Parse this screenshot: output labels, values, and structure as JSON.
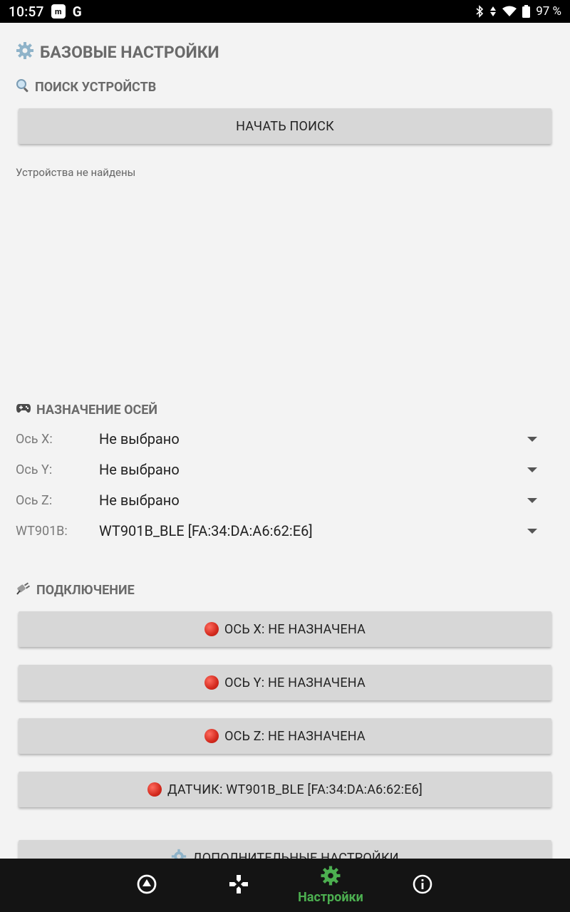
{
  "status_bar": {
    "time": "10:57",
    "app_badge": "m",
    "google_letter": "G",
    "battery_percent": "97 %"
  },
  "page": {
    "title": "БАЗОВЫЕ НАСТРОЙКИ",
    "title_icon": "gear-icon"
  },
  "search": {
    "heading": "ПОИСК УСТРОЙСТВ",
    "heading_icon": "magnifier-icon",
    "button_label": "НАЧАТЬ ПОИСК",
    "empty_message": "Устройства не найдены"
  },
  "axes": {
    "heading": "НАЗНАЧЕНИЕ ОСЕЙ",
    "heading_icon": "gamepad-icon",
    "rows": [
      {
        "label": "Ось X:",
        "value": "Не выбрано"
      },
      {
        "label": "Ось Y:",
        "value": "Не выбрано"
      },
      {
        "label": "Ось Z:",
        "value": "Не выбрано"
      },
      {
        "label": "WT901B:",
        "value": "WT901B_BLE [FA:34:DA:A6:62:E6]"
      }
    ]
  },
  "connection": {
    "heading": "ПОДКЛЮЧЕНИЕ",
    "heading_icon": "plug-icon",
    "status_color": "#e53935",
    "buttons": [
      {
        "label": "ОСЬ X: НЕ НАЗНАЧЕНА"
      },
      {
        "label": "ОСЬ Y: НЕ НАЗНАЧЕНА"
      },
      {
        "label": "ОСЬ Z: НЕ НАЗНАЧЕНА"
      },
      {
        "label": "ДАТЧИК: WT901B_BLE [FA:34:DA:A6:62:E6]"
      }
    ],
    "more_settings_label": "ДОПОЛНИТЕЛЬНЫЕ НАСТРОЙКИ"
  },
  "bottom_nav": {
    "active_color": "#4caf50",
    "items": [
      {
        "icon": "navigation-arrow-icon",
        "label": ""
      },
      {
        "icon": "gamepad-cross-icon",
        "label": ""
      },
      {
        "icon": "settings-gear-icon",
        "label": "Настройки"
      },
      {
        "icon": "info-icon",
        "label": ""
      }
    ]
  }
}
